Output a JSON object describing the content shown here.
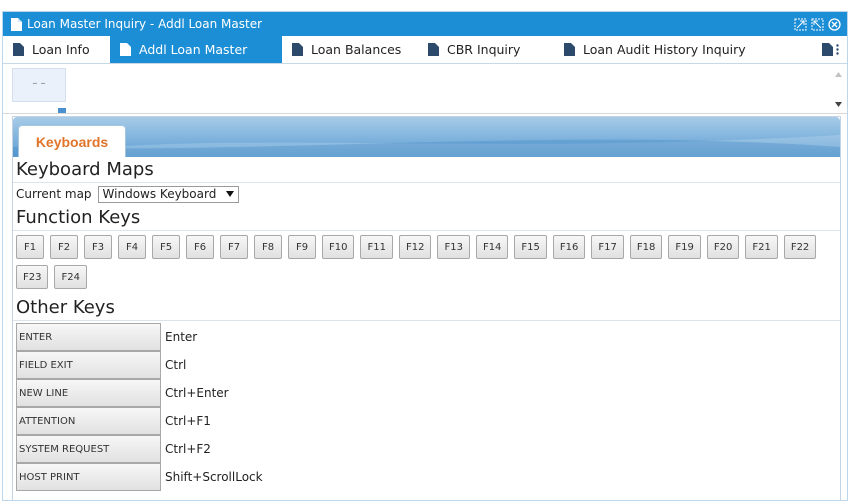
{
  "window": {
    "title": "Loan Master Inquiry - Addl Loan Master"
  },
  "tabs": [
    {
      "label": "Loan Info",
      "active": false
    },
    {
      "label": "Addl Loan Master",
      "active": true
    },
    {
      "label": "Loan Balances",
      "active": false
    },
    {
      "label": "CBR Inquiry",
      "active": false
    },
    {
      "label": "Loan Audit History Inquiry",
      "active": false
    }
  ],
  "thumbnail_text": "– –",
  "panel": {
    "tab_label": "Keyboards",
    "keyboard_maps_heading": "Keyboard Maps",
    "current_map_label": "Current map",
    "current_map_value": "Windows Keyboard",
    "function_keys_heading": "Function Keys",
    "function_keys": [
      "F1",
      "F2",
      "F3",
      "F4",
      "F5",
      "F6",
      "F7",
      "F8",
      "F9",
      "F10",
      "F11",
      "F12",
      "F13",
      "F14",
      "F15",
      "F16",
      "F17",
      "F18",
      "F19",
      "F20",
      "F21",
      "F22",
      "F23",
      "F24"
    ],
    "other_keys_heading": "Other Keys",
    "other_keys": [
      {
        "key": "ENTER",
        "value": "Enter"
      },
      {
        "key": "FIELD EXIT",
        "value": "Ctrl"
      },
      {
        "key": "NEW LINE",
        "value": "Ctrl+Enter"
      },
      {
        "key": "ATTENTION",
        "value": "Ctrl+F1"
      },
      {
        "key": "SYSTEM REQUEST",
        "value": "Ctrl+F2"
      },
      {
        "key": "HOST PRINT",
        "value": "Shift+ScrollLock"
      }
    ]
  },
  "colors": {
    "titlebar": "#1b8ed6",
    "active_tab": "#1b8ed6",
    "panel_tab_text": "#e0742b"
  },
  "icons": {
    "tab_icon": "document-icon",
    "window_controls": [
      "restore-icon",
      "maximize-icon",
      "close-icon"
    ]
  }
}
